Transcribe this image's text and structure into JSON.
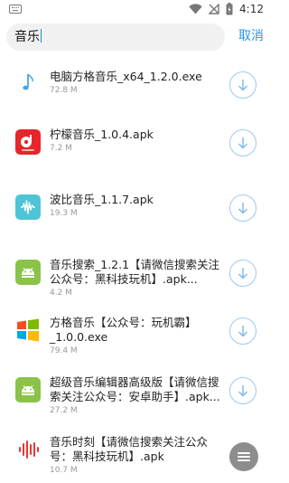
{
  "status": {
    "time": "4:12"
  },
  "search": {
    "query": "音乐",
    "cancel_label": "取消"
  },
  "files": [
    {
      "name": "电脑方格音乐_x64_1.2.0.exe",
      "size": "72.8 M",
      "icon": "music-note-icon"
    },
    {
      "name": "柠檬音乐_1.0.4.apk",
      "size": "7.2 M",
      "icon": "lemon-music-app-icon"
    },
    {
      "name": "波比音乐_1.1.7.apk",
      "size": "19.3 M",
      "icon": "waveform-app-icon"
    },
    {
      "name": "音乐搜索_1.2.1【请微信搜索关注公众号：黑科技玩机】.apk...",
      "size": "4.2 M",
      "icon": "android-icon"
    },
    {
      "name": "方格音乐【公众号：玩机霸】_1.0.0.exe",
      "size": "79.4 M",
      "icon": "windows-icon"
    },
    {
      "name": "超级音乐编辑器高级版【请微信搜索关注公众号：安卓助手】.apk...",
      "size": "27.2 M",
      "icon": "android-icon"
    },
    {
      "name": "音乐时刻【请微信搜索关注公众号：黑科技玩机】.apk",
      "size": "10.7 M",
      "icon": "sound-bars-icon"
    }
  ],
  "colors": {
    "accent": "#2196f3",
    "android": "#8bc34a"
  }
}
